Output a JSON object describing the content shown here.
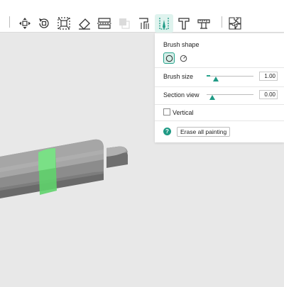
{
  "toolbar": {
    "tools": [
      {
        "name": "move-icon"
      },
      {
        "name": "rotate-icon"
      },
      {
        "name": "scale-icon"
      },
      {
        "name": "place-on-face-icon"
      },
      {
        "name": "cut-icon"
      },
      {
        "name": "variable-layer-height-icon"
      },
      {
        "name": "support-painting-icon"
      },
      {
        "name": "seam-painting-icon"
      },
      {
        "name": "text-icon"
      },
      {
        "name": "measure-icon"
      },
      {
        "name": "assembly-icon"
      }
    ]
  },
  "panel": {
    "brush_shape_label": "Brush shape",
    "brush_size_label": "Brush size",
    "brush_size_value": "1.00",
    "brush_size_level": 0.08,
    "section_view_label": "Section view",
    "section_view_value": "0.00",
    "section_view_level": 0.0,
    "vertical_label": "Vertical",
    "vertical_checked": false,
    "help_icon_glyph": "?",
    "erase_button_label": "Erase all painting"
  },
  "colors": {
    "accent": "#26a38b",
    "model_gray": "#9c9c9c",
    "paint_green": "#5fd36b",
    "background": "#e8e8e8"
  }
}
